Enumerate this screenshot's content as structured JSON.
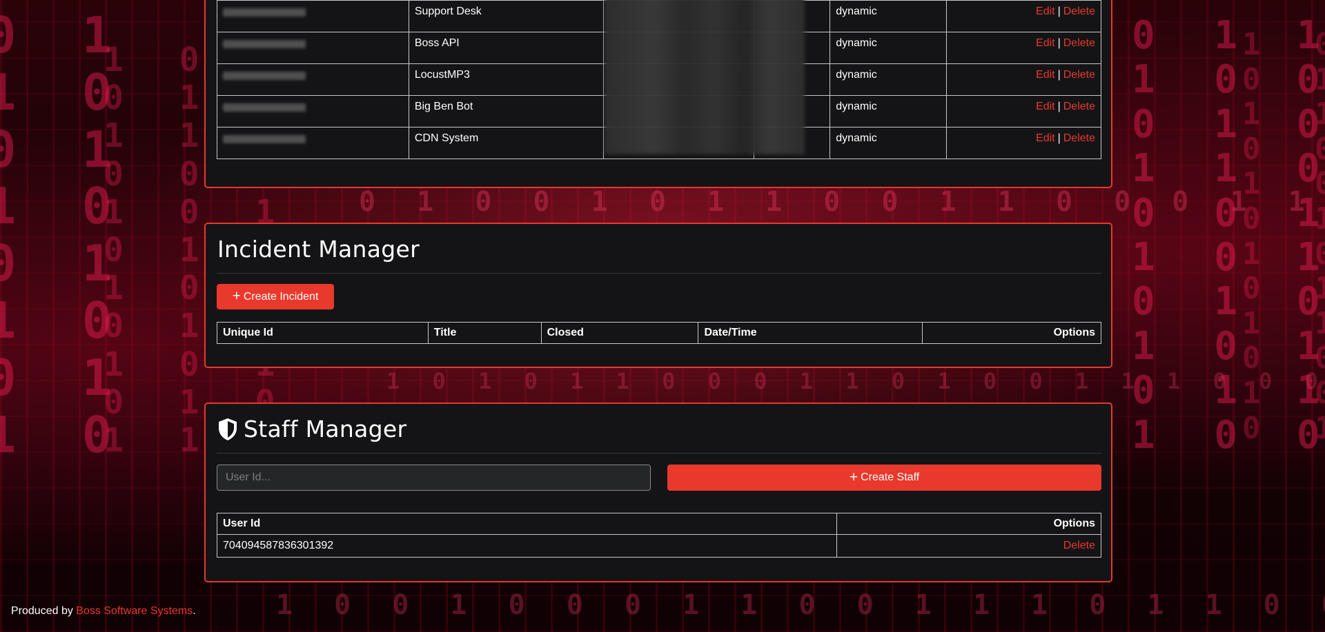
{
  "services": {
    "rows": [
      {
        "name": "Support Desk",
        "type": "dynamic"
      },
      {
        "name": "Boss API",
        "type": "dynamic"
      },
      {
        "name": "LocustMP3",
        "type": "dynamic"
      },
      {
        "name": "Big Ben Bot",
        "type": "dynamic"
      },
      {
        "name": "CDN System",
        "type": "dynamic"
      }
    ],
    "edit_label": "Edit",
    "delete_label": "Delete",
    "separator": "|"
  },
  "incident": {
    "title": "Incident Manager",
    "create_label": "Create Incident",
    "columns": [
      "Unique Id",
      "Title",
      "Closed",
      "Date/Time",
      "Options"
    ]
  },
  "staff": {
    "title": "Staff Manager",
    "input_placeholder": "User Id...",
    "create_label": "Create Staff",
    "columns": [
      "User Id",
      "Options"
    ],
    "rows": [
      {
        "user_id": "704094587836301392",
        "delete_label": "Delete"
      }
    ]
  },
  "footer": {
    "prefix": "Produced by",
    "link": "Boss Software Systems",
    "suffix": "."
  },
  "colors": {
    "accent": "#e8392c",
    "card_bg": "#141416",
    "input_bg": "#242628"
  }
}
